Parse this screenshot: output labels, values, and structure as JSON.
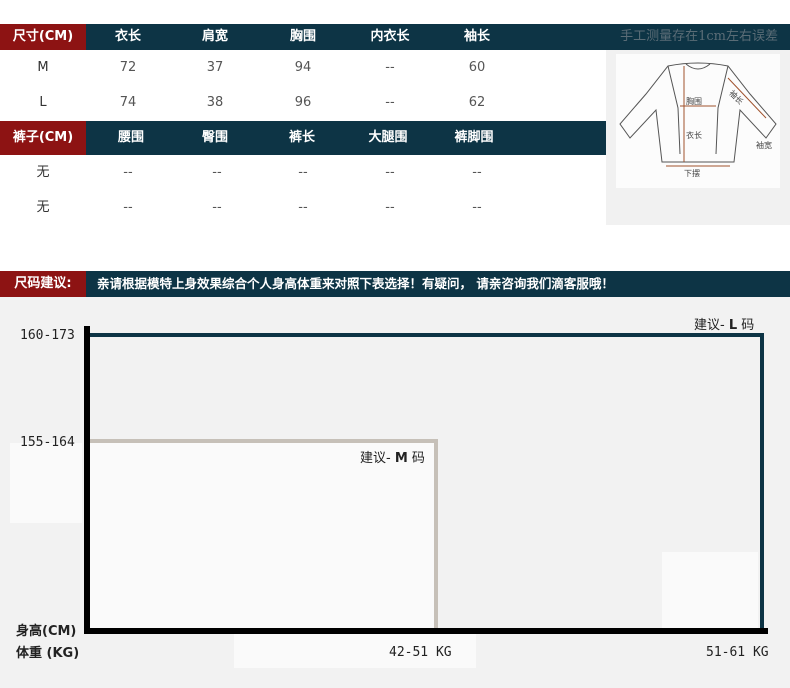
{
  "top_table": {
    "header": [
      "尺寸(CM)",
      "衣长",
      "肩宽",
      "胸围",
      "内衣长",
      "袖长"
    ],
    "rows": [
      [
        "M",
        "72",
        "37",
        "94",
        "--",
        "60"
      ],
      [
        "L",
        "74",
        "38",
        "96",
        "--",
        "62"
      ]
    ]
  },
  "pants_table": {
    "header": [
      "裤子(CM)",
      "腰围",
      "臀围",
      "裤长",
      "大腿围",
      "裤脚围"
    ],
    "rows": [
      [
        "无",
        "--",
        "--",
        "--",
        "--",
        "--"
      ],
      [
        "无",
        "--",
        "--",
        "--",
        "--",
        "--"
      ]
    ]
  },
  "measure_note": "手工测量存在1cm左右误差",
  "diagram_labels": {
    "chest": "胸围",
    "length": "衣长",
    "sleeve": "袖长",
    "cuff": "袖宽",
    "hem": "下摆"
  },
  "recommendation": {
    "label": "尺码建议:",
    "text": "亲请根据模特上身效果综合个人身高体重来对照下表选择！有疑问， 请亲咨询我们滴客服哦！"
  },
  "chart_data": {
    "type": "area",
    "xlabel": "体重 (KG)",
    "ylabel": "身高(CM)",
    "x_ticks": [
      "42-51 KG",
      "51-61 KG"
    ],
    "y_ticks": [
      "155-164",
      "160-173"
    ],
    "regions": [
      {
        "prefix": "建议-",
        "size": "M",
        "suffix": "码",
        "weight": "42-51 KG",
        "height": "155-164"
      },
      {
        "prefix": "建议-",
        "size": "L",
        "suffix": "码",
        "weight": "51-61 KG",
        "height": "160-173"
      }
    ]
  },
  "colors": {
    "header_dark": "#0d3445",
    "header_red": "#8d1313",
    "m_line": "#c6c0b8",
    "l_line": "#0d3445"
  }
}
